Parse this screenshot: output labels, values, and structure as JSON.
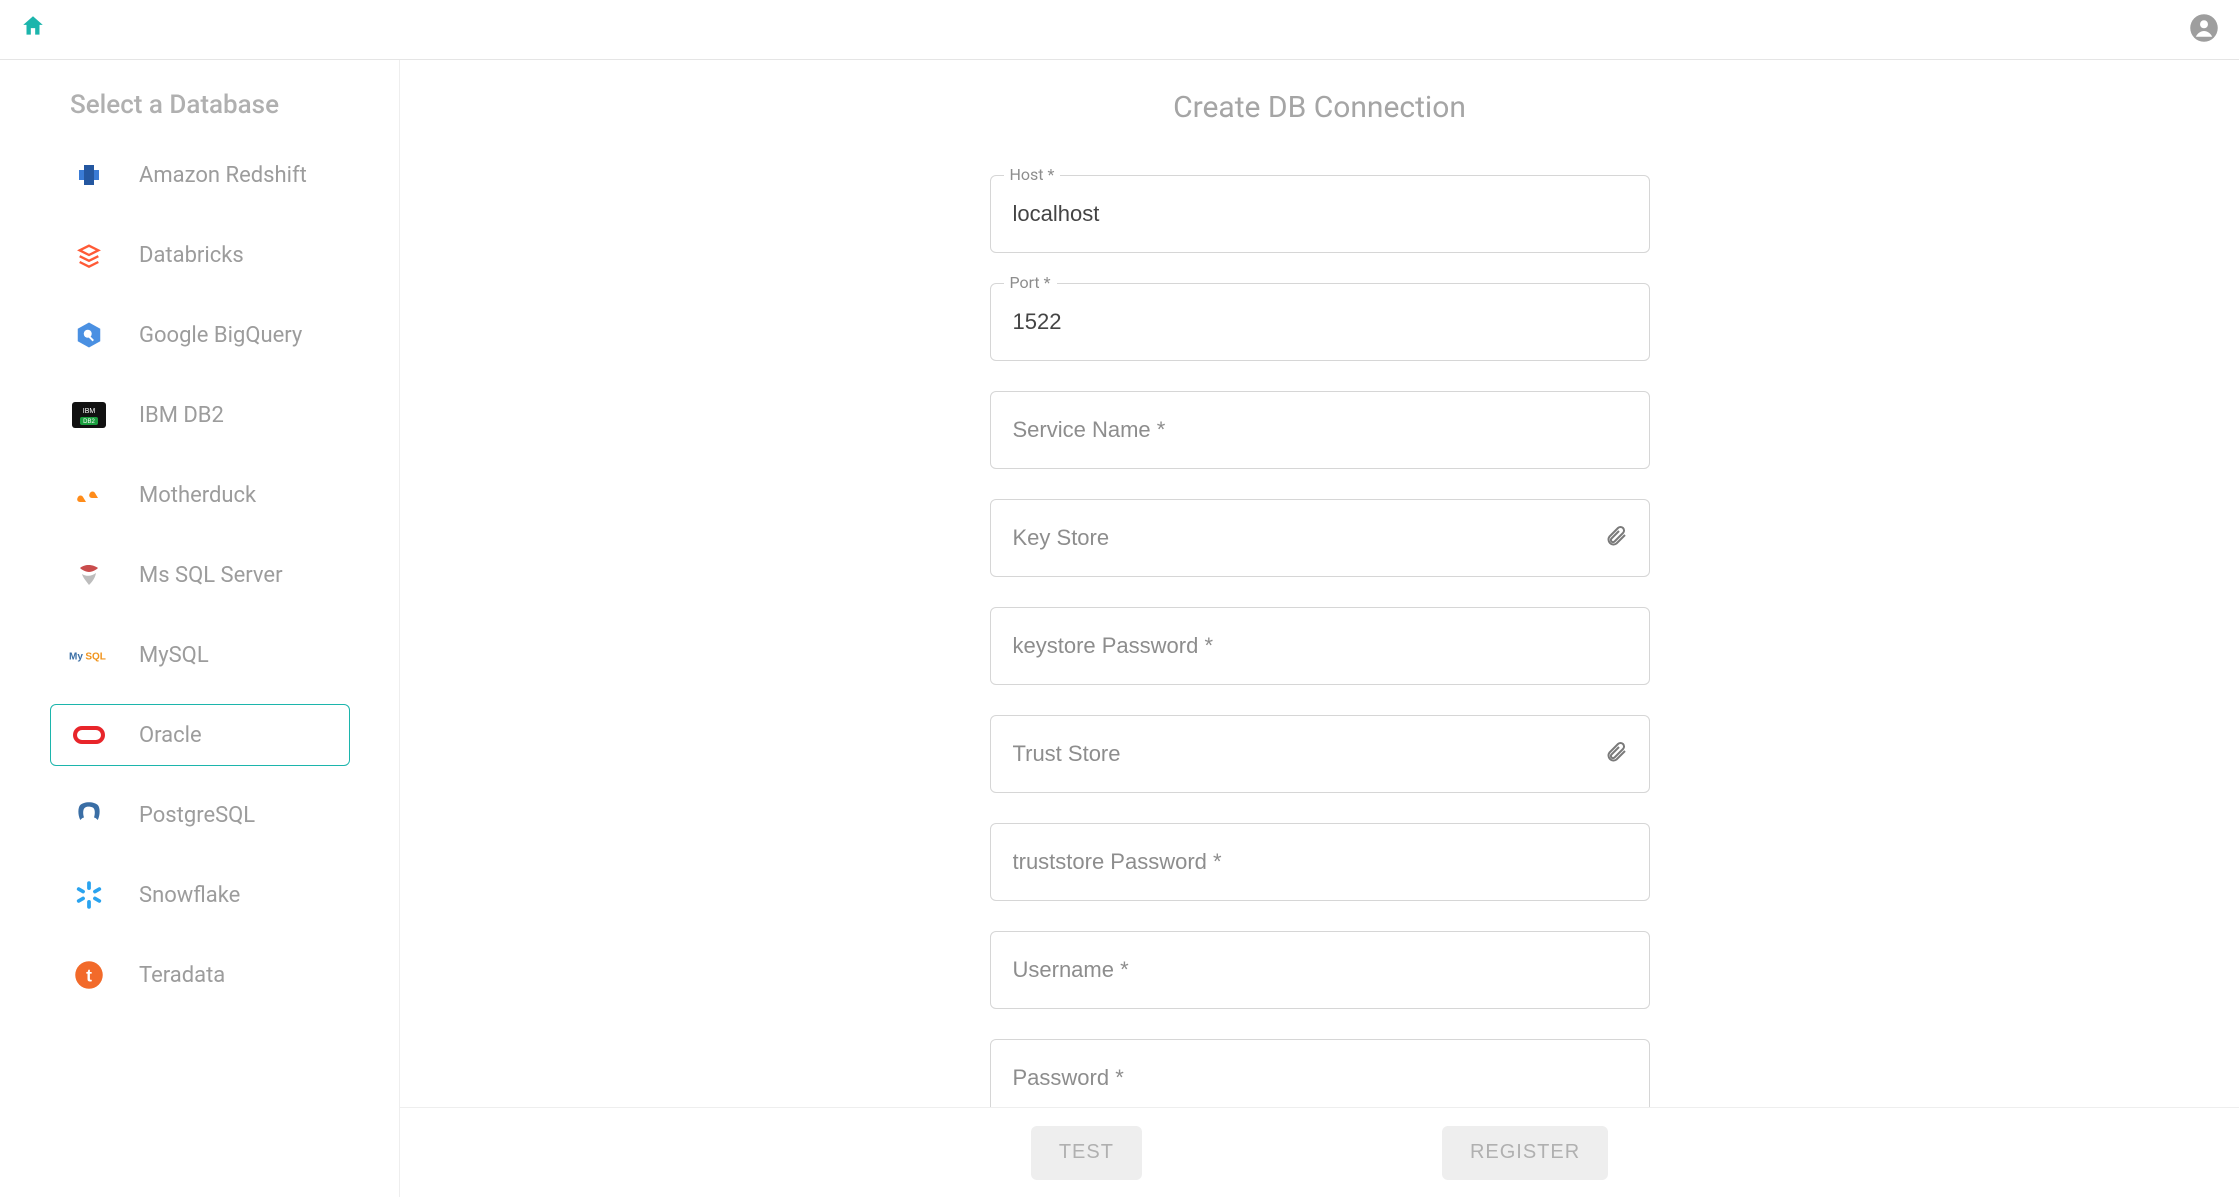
{
  "sidebar": {
    "title": "Select a Database",
    "items": [
      {
        "id": "amazon-redshift",
        "label": "Amazon Redshift"
      },
      {
        "id": "databricks",
        "label": "Databricks"
      },
      {
        "id": "google-bigquery",
        "label": "Google BigQuery"
      },
      {
        "id": "ibm-db2",
        "label": "IBM DB2"
      },
      {
        "id": "motherduck",
        "label": "Motherduck"
      },
      {
        "id": "ms-sql-server",
        "label": "Ms SQL Server"
      },
      {
        "id": "mysql",
        "label": "MySQL"
      },
      {
        "id": "oracle",
        "label": "Oracle",
        "selected": true
      },
      {
        "id": "postgresql",
        "label": "PostgreSQL"
      },
      {
        "id": "snowflake",
        "label": "Snowflake"
      },
      {
        "id": "teradata",
        "label": "Teradata"
      }
    ]
  },
  "form": {
    "title": "Create DB Connection",
    "fields": {
      "host": {
        "label": "Host *",
        "value": "localhost"
      },
      "port": {
        "label": "Port *",
        "value": "1522"
      },
      "service_name": {
        "label": "Service Name *",
        "value": ""
      },
      "key_store": {
        "label": "Key Store",
        "value": ""
      },
      "keystore_password": {
        "label": "keystore Password *",
        "value": ""
      },
      "trust_store": {
        "label": "Trust Store",
        "value": ""
      },
      "truststore_password": {
        "label": "truststore Password *",
        "value": ""
      },
      "username": {
        "label": "Username *",
        "value": ""
      },
      "password": {
        "label": "Password *",
        "value": ""
      }
    },
    "buttons": {
      "test": "TEST",
      "register": "REGISTER"
    }
  }
}
